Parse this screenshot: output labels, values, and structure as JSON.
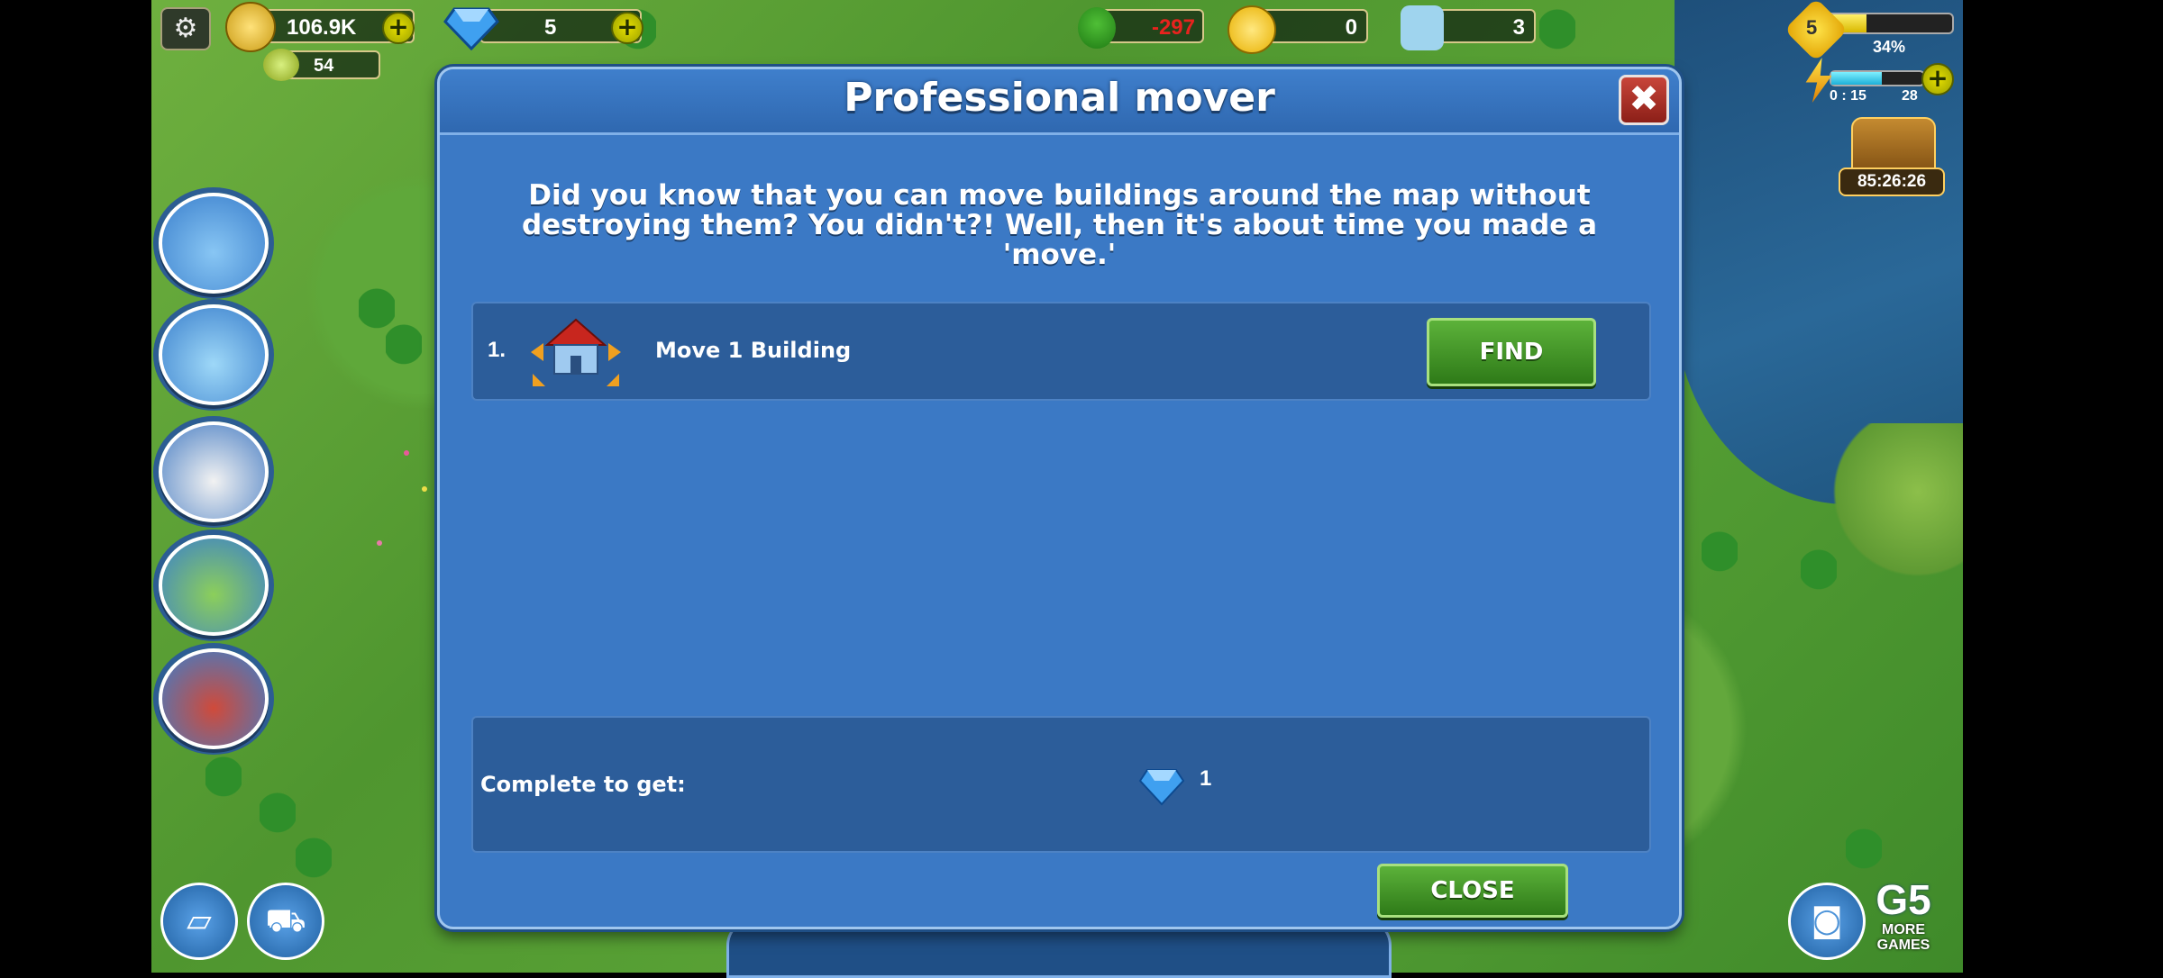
{
  "hud": {
    "coins": "106.9K",
    "coins_secondary": "54",
    "gems": "5",
    "ecology": "-297",
    "happiness": "0",
    "population": "3",
    "level": "5",
    "xp_percent": "34%",
    "xp_fraction": 0.34,
    "energy_timer": "0 : 15",
    "energy_value": "28",
    "energy_fraction": 0.55,
    "chest_timer": "85:26:26",
    "more_games_label": "MORE\nGAMES",
    "g5_label": "G5"
  },
  "icons": {
    "settings": "gear-icon",
    "coins": "coins-icon",
    "gems": "gem-icon",
    "ecology": "tree-icon",
    "happiness": "smiley-icon",
    "population": "people-icon",
    "level": "star-icon",
    "energy": "lightning-icon",
    "chest": "treasure-chest-icon"
  },
  "dialog": {
    "title": "Professional mover",
    "description": "Did you know that you can move buildings around the map without destroying them? You didn't?! Well, then it's about time you made a 'move.'",
    "tasks": [
      {
        "number": "1.",
        "label": "Move 1 Building",
        "button": "FIND"
      }
    ],
    "reward_label": "Complete to get:",
    "reward_value": "1",
    "close_label": "CLOSE"
  },
  "colors": {
    "dialog_bg": "#3b79c5",
    "panel_bg": "#2c5d9a",
    "button_green": "#3f9a22",
    "close_red": "#b03328",
    "ecology_negative": "#e8231e"
  }
}
